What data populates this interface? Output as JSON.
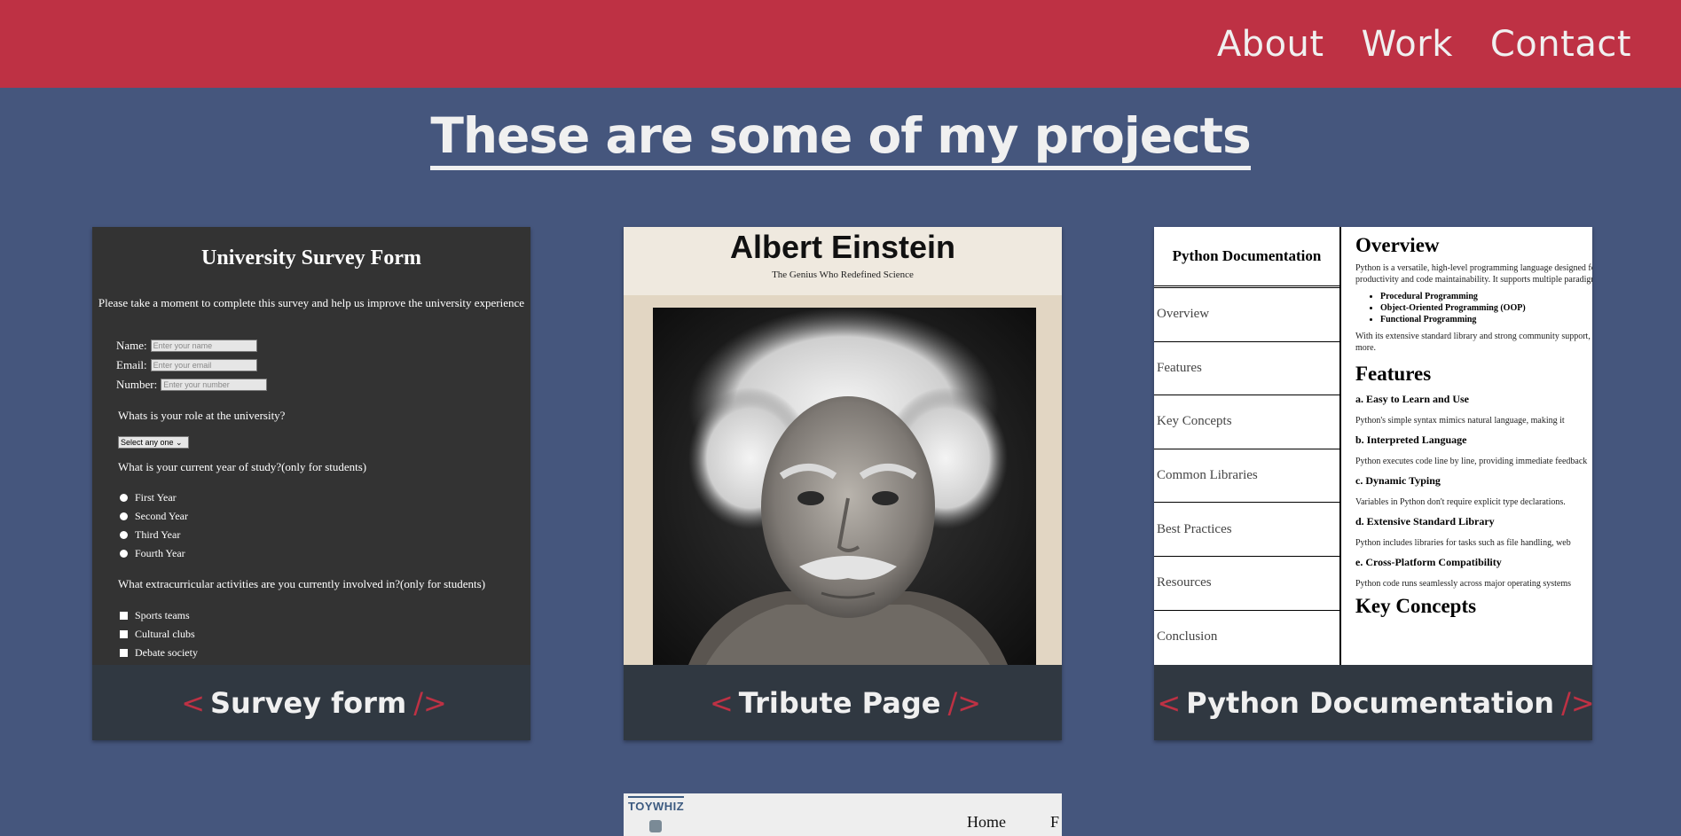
{
  "nav": {
    "links": [
      "About",
      "Work",
      "Contact"
    ]
  },
  "heading": "These are some of my projects",
  "colors": {
    "navbar": "#be3144",
    "background": "#45567d",
    "tile": "#303841",
    "accent": "#be3144"
  },
  "projects": [
    {
      "title": "Survey form",
      "open": "<",
      "close": "/>",
      "preview": {
        "title": "University Survey Form",
        "description": "Please take a moment to complete this survey and help us improve the university experience",
        "fields": [
          {
            "label": "Name:",
            "placeholder": "Enter your name"
          },
          {
            "label": "Email:",
            "placeholder": "Enter your email"
          },
          {
            "label": "Number:",
            "placeholder": "Enter your number"
          }
        ],
        "q1": "Whats is your role at the university?",
        "select": "Select any one",
        "q2": "What is your current year of study?(only for students)",
        "years": [
          "First Year",
          "Second Year",
          "Third Year",
          "Fourth Year"
        ],
        "q3": "What extracurricular activities are you currently involved in?(only for students)",
        "activities": [
          "Sports teams",
          "Cultural clubs",
          "Debate society"
        ]
      }
    },
    {
      "title": "Tribute Page",
      "open": "<",
      "close": "/>",
      "preview": {
        "name": "Albert Einstein",
        "subtitle": "The Genius Who Redefined Science"
      }
    },
    {
      "title": "Python Documentation",
      "open": "<",
      "close": "/>",
      "preview": {
        "nav_title": "Python Documentation",
        "nav_links": [
          "Overview",
          "Features",
          "Key Concepts",
          "Common Libraries",
          "Best Practices",
          "Resources",
          "Conclusion"
        ],
        "overview_heading": "Overview",
        "overview_p1": "Python is a versatile, high-level programming language designed for",
        "overview_p2": "productivity and code maintainability. It supports multiple paradigms:",
        "paradigms": [
          "Procedural Programming",
          "Object-Oriented Programming (OOP)",
          "Functional Programming"
        ],
        "overview_p3": "With its extensive standard library and strong community support, and",
        "overview_p4": "more.",
        "features_heading": "Features",
        "features": [
          {
            "title": "a. Easy to Learn and Use",
            "text": "Python's simple syntax mimics natural language, making it"
          },
          {
            "title": "b. Interpreted Language",
            "text": "Python executes code line by line, providing immediate feedback"
          },
          {
            "title": "c. Dynamic Typing",
            "text": "Variables in Python don't require explicit type declarations."
          },
          {
            "title": "d. Extensive Standard Library",
            "text": "Python includes libraries for tasks such as file handling, web"
          },
          {
            "title": "e. Cross-Platform Compatibility",
            "text": "Python code runs seamlessly across major operating systems"
          }
        ],
        "next_heading": "Key Concepts"
      }
    }
  ],
  "partial_tile": {
    "logo": "TOYWHIZ",
    "nav_home": "Home",
    "nav_next": "F"
  }
}
